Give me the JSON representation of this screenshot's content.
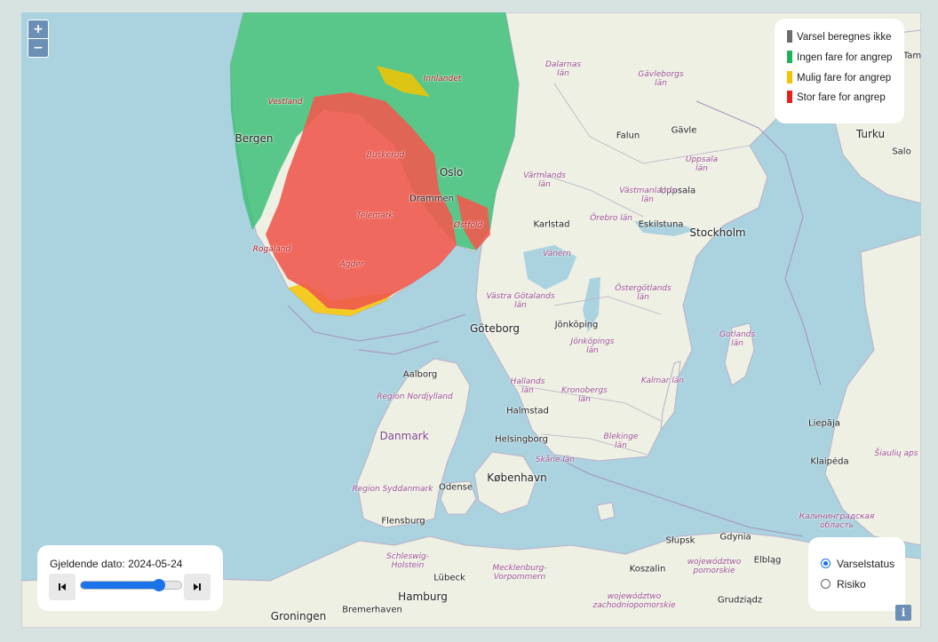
{
  "zoom": {
    "in_label": "+",
    "out_label": "−"
  },
  "legend": {
    "items": [
      {
        "label": "Varsel beregnes ikke",
        "color": "#6b6b6b"
      },
      {
        "label": "Ingen fare for angrep",
        "color": "#1fb25a"
      },
      {
        "label": "Mulig fare for angrep",
        "color": "#f5c400"
      },
      {
        "label": "Stor fare for angrep",
        "color": "#e8201c"
      }
    ]
  },
  "date_panel": {
    "label": "Gjeldende dato: 2024-05-24",
    "slider_position": 0.78
  },
  "view_options": {
    "options": [
      "Varselstatus",
      "Risiko"
    ],
    "selected": "Varselstatus"
  },
  "map_labels": {
    "bergen": "Bergen",
    "oslo": "Oslo",
    "drammen": "Drammen",
    "stockholm": "Stockholm",
    "goteborg": "Göteborg",
    "kobenhavn": "København",
    "hamburg": "Hamburg",
    "groningen": "Groningen",
    "bremerhaven": "Bremerhaven",
    "falun": "Falun",
    "gavle": "Gävle",
    "uppsala": "Uppsala",
    "karlstad": "Karlstad",
    "eskilstuna": "Eskilstuna",
    "jonkoping": "Jönköping",
    "halmstad": "Halmstad",
    "helsingborg": "Helsingborg",
    "aalborg": "Aalborg",
    "odense": "Odense",
    "flensburg": "Flensburg",
    "lubeck": "Lübeck",
    "turku": "Turku",
    "salo": "Salo",
    "tam": "Tam",
    "liepaja": "Liepāja",
    "klaipeda": "Klaipėda",
    "slupsk": "Słupsk",
    "gdynia": "Gdynia",
    "elblag": "Elbląg",
    "koszalin": "Koszalin",
    "grudziadz": "Grudziądz",
    "danmark": "Danmark",
    "dalarnas": "Dalarnas\nlän",
    "gavleborgs": "Gävleborgs\nlän",
    "varmlands": "Värmlands\nlän",
    "vastmanlands": "Västmanlands\nlän",
    "uppsala_lan": "Uppsala\nlän",
    "orebro": "Örebro län",
    "ostergotlands": "Östergötlands\nlän",
    "vastra_gotalands": "Västra Götalands\nlän",
    "jonkopings": "Jönköpings\nlän",
    "hallands": "Hallands\nlän",
    "kronobergs": "Kronobergs\nlän",
    "kalmar": "Kalmar län",
    "blekinge": "Blekinge\nlän",
    "skane": "Skåne län",
    "gotlands": "Gotlands\nlän",
    "vanern": "Vänern",
    "nordjylland": "Region Nordjylland",
    "syddanmark": "Region Syddanmark",
    "schleswig": "Schleswig-\nHolstein",
    "mecklenburg": "Mecklenburg-\nVorpommern",
    "pomorskie": "województwo\npomorskie",
    "zachodnio": "województwo\nzachodniopomorskie",
    "siauliu": "Šiaulių aps",
    "kaliningrad": "Калининградская\nобласть",
    "buskerud": "Buskerud",
    "telemark": "Telemark",
    "agder": "Agder",
    "rogaland": "Rogaland",
    "vestland": "Vestland",
    "innlandet": "Innlandet",
    "ostfold": "Østfold"
  }
}
